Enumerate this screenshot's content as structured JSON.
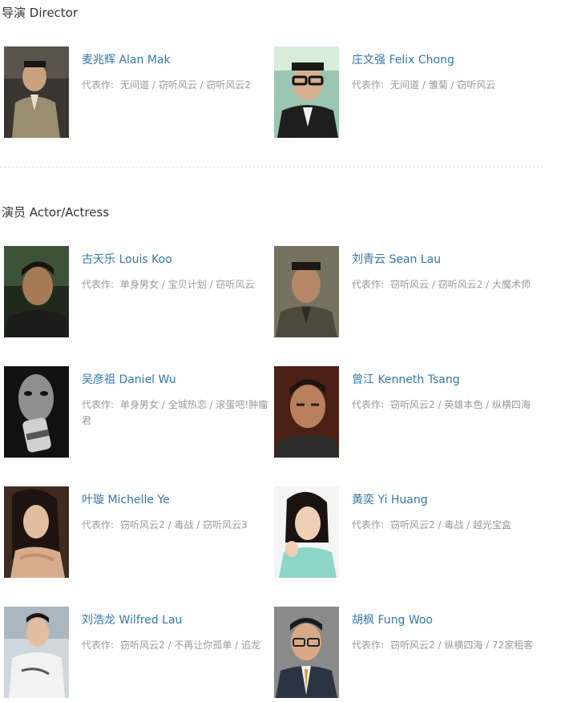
{
  "director_section": {
    "title": "导演 Director"
  },
  "actor_section": {
    "title": "演员 Actor/Actress"
  },
  "works_label": "代表作:",
  "directors": [
    {
      "name": "麦兆辉 Alan Mak",
      "works": "无间道 / 窃听风云 / 窃听风云2"
    },
    {
      "name": "庄文强 Felix Chong",
      "works": "无间道 / 雏菊 / 窃听风云"
    }
  ],
  "actors": [
    {
      "name": "古天乐 Louis Koo",
      "works": "单身男女 / 宝贝计划 / 窃听风云"
    },
    {
      "name": "刘青云 Sean Lau",
      "works": "窃听风云 / 窃听风云2 / 大魔术师"
    },
    {
      "name": "吴彦祖 Daniel Wu",
      "works": "单身男女 / 全城热恋 / 滚蛋吧!肿瘤君"
    },
    {
      "name": "曾江 Kenneth Tsang",
      "works": "窃听风云2 / 英雄本色 / 纵横四海"
    },
    {
      "name": "叶璇 Michelle Ye",
      "works": "窃听风云2 / 毒战 / 窃听风云3"
    },
    {
      "name": "黄奕 Yi Huang",
      "works": "窃听风云2 / 毒战 / 越光宝盒"
    },
    {
      "name": "刘浩龙 Wilfred Lau",
      "works": "窃听风云2 / 不再让你孤单 / 追龙"
    },
    {
      "name": "胡枫 Fung Woo",
      "works": "窃听风云2 / 纵横四海 / 72家租客"
    }
  ]
}
